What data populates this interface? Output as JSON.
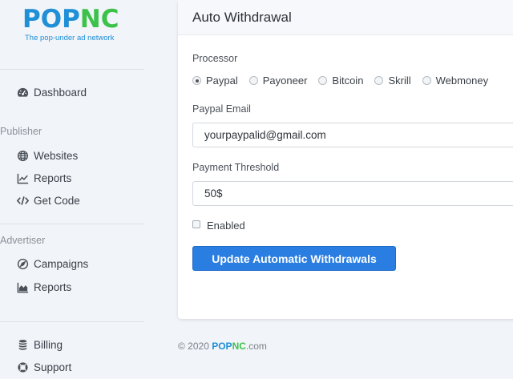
{
  "brand": {
    "logo_pop": "POP",
    "logo_nc": "NC",
    "tagline": "The pop-under ad network",
    "colors": {
      "blue": "#1f8fd6",
      "green": "#3cc24a"
    }
  },
  "sidebar": {
    "dashboard": "Dashboard",
    "publisher_label": "Publisher",
    "publisher_items": [
      "Websites",
      "Reports",
      "Get Code"
    ],
    "advertiser_label": "Advertiser",
    "advertiser_items": [
      "Campaigns",
      "Reports"
    ],
    "bottom_items": [
      "Billing",
      "Support"
    ]
  },
  "card": {
    "title": "Auto Withdrawal",
    "processor_label": "Processor",
    "processors": [
      "Paypal",
      "Payoneer",
      "Bitcoin",
      "Skrill",
      "Webmoney"
    ],
    "selected_processor": "Paypal",
    "email_label": "Paypal Email",
    "email_value": "yourpaypalid@gmail.com",
    "threshold_label": "Payment Threshold",
    "threshold_value": "50$",
    "enabled_label": "Enabled",
    "enabled_checked": false,
    "submit_label": "Update Automatic Withdrawals",
    "accent": "#2a7de1"
  },
  "footer": {
    "copyright": "© 2020",
    "brand_pop": "POP",
    "brand_nc": "NC",
    "suffix": ".com"
  }
}
